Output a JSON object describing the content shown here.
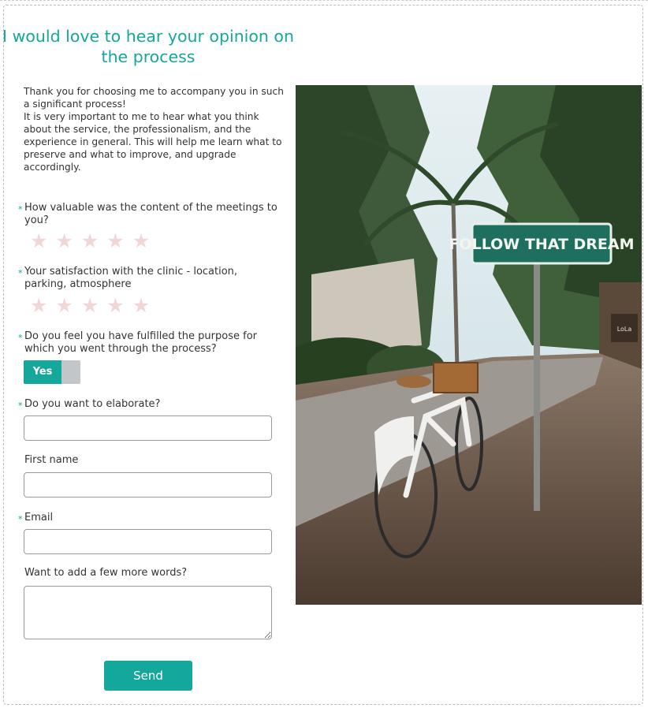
{
  "form": {
    "title": "I would love to hear your opinion on the process",
    "intro_lines": [
      "Thank you for choosing me to accompany you in such a significant process!",
      "It is very important to me to hear what you think about the service, the professionalism, and the experience in general. This will help me learn what to preserve and what to improve, and upgrade accordingly."
    ],
    "required_mark": "*",
    "questions": {
      "q1": {
        "label": "How valuable was the content of the meetings to you?",
        "rating": 0,
        "max": 5
      },
      "q2": {
        "label": "Your satisfaction with the clinic - location, parking, atmosphere",
        "rating": 0,
        "max": 5
      },
      "q3": {
        "label": "Do you feel you have fulfilled the purpose for which you went through the process?",
        "toggle_label": "Yes"
      },
      "q4": {
        "label": "Do you want to elaborate?",
        "value": ""
      }
    },
    "first_name": {
      "label": "First name",
      "value": ""
    },
    "email": {
      "label": "Email",
      "value": ""
    },
    "more_words": {
      "label": "Want to add a few more words?",
      "value": ""
    },
    "send_label": "Send"
  },
  "image": {
    "sign_text": "FOLLOW THAT DREAM",
    "small_sign_text": "LoLa"
  },
  "colors": {
    "accent": "#14a79b",
    "star_empty": "#f1d6d8",
    "toggle_off": "#c2c6c9"
  }
}
